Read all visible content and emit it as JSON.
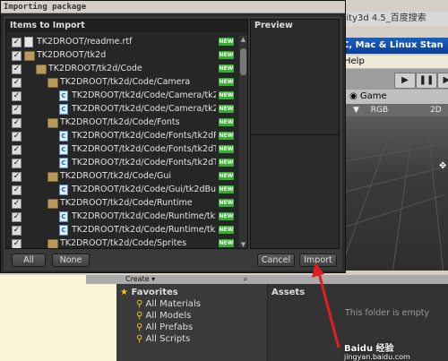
{
  "dialog": {
    "title": "Importing package",
    "items_header": "Items to Import",
    "preview_header": "Preview",
    "buttons": {
      "all": "All",
      "none": "None",
      "cancel": "Cancel",
      "import": "Import"
    },
    "new_badge": "NEW",
    "items": [
      {
        "type": "file",
        "level": 0,
        "label": "TK2DROOT/readme.rtf",
        "checked": true
      },
      {
        "type": "folder",
        "level": 0,
        "label": "TK2DROOT/tk2d",
        "checked": true
      },
      {
        "type": "folder",
        "level": 1,
        "label": "TK2DROOT/tk2d/Code",
        "checked": true
      },
      {
        "type": "folder",
        "level": 2,
        "label": "TK2DROOT/tk2d/Code/Camera",
        "checked": true
      },
      {
        "type": "script",
        "level": 3,
        "label": "TK2DROOT/tk2d/Code/Camera/tk2dC",
        "checked": true
      },
      {
        "type": "script",
        "level": 3,
        "label": "TK2DROOT/tk2d/Code/Camera/tk2dC",
        "checked": true
      },
      {
        "type": "folder",
        "level": 2,
        "label": "TK2DROOT/tk2d/Code/Fonts",
        "checked": true
      },
      {
        "type": "script",
        "level": 3,
        "label": "TK2DROOT/tk2d/Code/Fonts/tk2dFo",
        "checked": true
      },
      {
        "type": "script",
        "level": 3,
        "label": "TK2DROOT/tk2d/Code/Fonts/tk2dTe",
        "checked": true
      },
      {
        "type": "script",
        "level": 3,
        "label": "TK2DROOT/tk2d/Code/Fonts/tk2dTe",
        "checked": true
      },
      {
        "type": "folder",
        "level": 2,
        "label": "TK2DROOT/tk2d/Code/Gui",
        "checked": true
      },
      {
        "type": "script",
        "level": 3,
        "label": "TK2DROOT/tk2d/Code/Gui/tk2dButto",
        "checked": true
      },
      {
        "type": "folder",
        "level": 2,
        "label": "TK2DROOT/tk2d/Code/Runtime",
        "checked": true
      },
      {
        "type": "script",
        "level": 3,
        "label": "TK2DROOT/tk2d/Code/Runtime/tk2dE",
        "checked": true
      },
      {
        "type": "script",
        "level": 3,
        "label": "TK2DROOT/tk2d/Code/Runtime/tk2dR",
        "checked": true
      },
      {
        "type": "folder",
        "level": 2,
        "label": "TK2DROOT/tk2d/Code/Sprites",
        "checked": true
      }
    ]
  },
  "background": {
    "title_fragment": "nity3d 4.5_百度搜索",
    "build_bar": "C, Mac & Linux Stan",
    "menu_help": "Help",
    "game_tab": "Game",
    "game_bar": {
      "rgb": "RGB",
      "mode": "2D"
    },
    "create_label": "Create",
    "favorites": {
      "title": "Favorites",
      "items": [
        "All Materials",
        "All Models",
        "All Prefabs",
        "All Scripts"
      ]
    },
    "assets_title": "Assets",
    "assets_empty": "This folder is empty"
  },
  "watermark": {
    "main": "Baidu 经验",
    "sub": "jingyan.baidu.com"
  },
  "colors": {
    "new_badge": "#33b030",
    "arrow": "#e02020",
    "dialog_bg": "#3a3a3a"
  }
}
